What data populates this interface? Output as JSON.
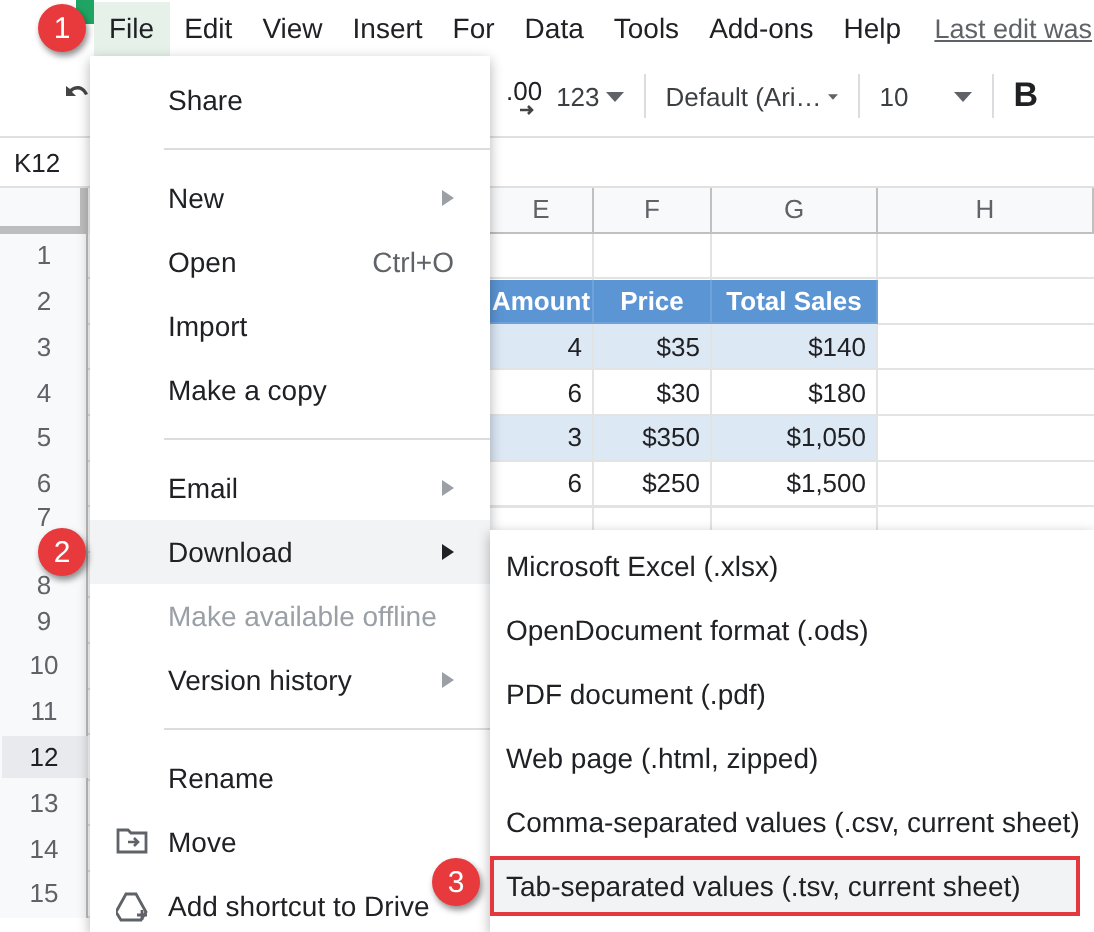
{
  "menubar": {
    "items": [
      {
        "label": "File",
        "selected": true
      },
      {
        "label": "Edit",
        "selected": false
      },
      {
        "label": "View",
        "selected": false
      },
      {
        "label": "Insert",
        "selected": false
      },
      {
        "label": "For",
        "selected": false
      },
      {
        "label": "Data",
        "selected": false
      },
      {
        "label": "Tools",
        "selected": false
      },
      {
        "label": "Add-ons",
        "selected": false
      },
      {
        "label": "Help",
        "selected": false
      }
    ],
    "last_edit": "Last edit was"
  },
  "toolbar": {
    "decimal": ".00",
    "number_format": "123",
    "font": "Default (Ari…",
    "font_size": "10",
    "bold": "B"
  },
  "name_box": "K12",
  "columns": [
    "E",
    "F",
    "G",
    "H"
  ],
  "row_headers": [
    {
      "label": "1",
      "selected": false
    },
    {
      "label": "2",
      "selected": false
    },
    {
      "label": "3",
      "selected": false
    },
    {
      "label": "4",
      "selected": false
    },
    {
      "label": "5",
      "selected": false
    },
    {
      "label": "6",
      "selected": false
    },
    {
      "label": "7",
      "selected": false
    },
    {
      "label": "8",
      "selected": false
    },
    {
      "label": "9",
      "selected": false
    },
    {
      "label": "10",
      "selected": false
    },
    {
      "label": "11",
      "selected": false
    },
    {
      "label": "12",
      "selected": true
    },
    {
      "label": "13",
      "selected": false
    },
    {
      "label": "14",
      "selected": false
    },
    {
      "label": "15",
      "selected": false
    }
  ],
  "table": {
    "header": [
      "Amount",
      "Price",
      "Total Sales"
    ],
    "rows": [
      [
        "4",
        "$35",
        "$140"
      ],
      [
        "6",
        "$30",
        "$180"
      ],
      [
        "3",
        "$350",
        "$1,050"
      ],
      [
        "6",
        "$250",
        "$1,500"
      ]
    ]
  },
  "file_menu": [
    {
      "kind": "item",
      "label": "Share",
      "submenu": false,
      "selected": false,
      "disabled": false
    },
    {
      "kind": "divider"
    },
    {
      "kind": "item",
      "label": "New",
      "submenu": true,
      "selected": false,
      "disabled": false
    },
    {
      "kind": "item",
      "label": "Open",
      "shortcut": "Ctrl+O",
      "submenu": false,
      "selected": false,
      "disabled": false
    },
    {
      "kind": "item",
      "label": "Import",
      "submenu": false,
      "selected": false,
      "disabled": false
    },
    {
      "kind": "item",
      "label": "Make a copy",
      "submenu": false,
      "selected": false,
      "disabled": false
    },
    {
      "kind": "divider"
    },
    {
      "kind": "item",
      "label": "Email",
      "submenu": true,
      "selected": false,
      "disabled": false
    },
    {
      "kind": "item",
      "label": "Download",
      "submenu": true,
      "selected": true,
      "disabled": false
    },
    {
      "kind": "item",
      "label": "Make available offline",
      "submenu": false,
      "selected": false,
      "disabled": true
    },
    {
      "kind": "item",
      "label": "Version history",
      "submenu": true,
      "selected": false,
      "disabled": false
    },
    {
      "kind": "divider"
    },
    {
      "kind": "item",
      "label": "Rename",
      "submenu": false,
      "selected": false,
      "disabled": false
    },
    {
      "kind": "folder-item",
      "label": "Move",
      "submenu": false,
      "selected": false,
      "disabled": false
    },
    {
      "kind": "drive-item",
      "label": "Add shortcut to Drive",
      "submenu": false,
      "selected": false,
      "disabled": false
    }
  ],
  "download_menu": [
    {
      "label": "Microsoft Excel (.xlsx)",
      "selected": false
    },
    {
      "label": "OpenDocument format (.ods)",
      "selected": false
    },
    {
      "label": "PDF document (.pdf)",
      "selected": false
    },
    {
      "label": "Web page (.html, zipped)",
      "selected": false
    },
    {
      "label": "Comma-separated values (.csv, current sheet)",
      "selected": false
    },
    {
      "label": "Tab-separated values (.tsv, current sheet)",
      "selected": true
    }
  ],
  "badges": [
    {
      "label": "1"
    },
    {
      "label": "2"
    },
    {
      "label": "3"
    }
  ]
}
